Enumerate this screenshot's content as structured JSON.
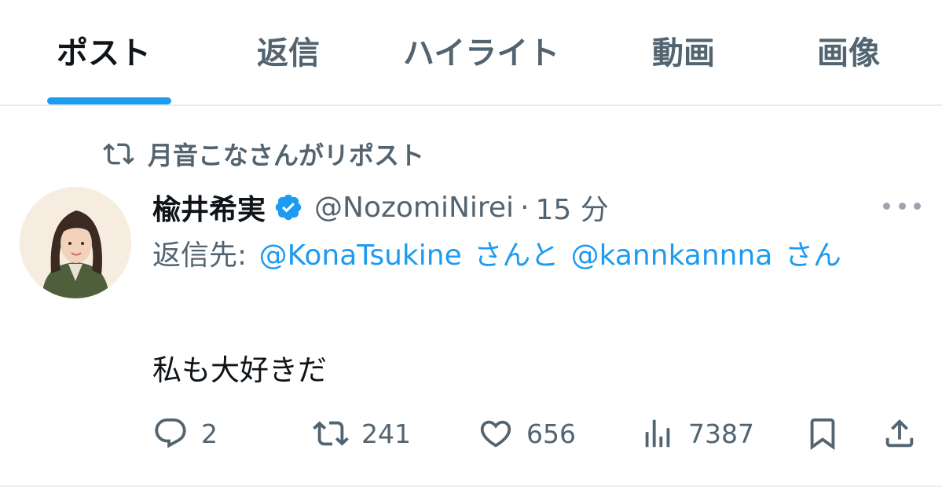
{
  "tabs": [
    {
      "label": "ポスト",
      "active": true
    },
    {
      "label": "返信",
      "active": false
    },
    {
      "label": "ハイライト",
      "active": false
    },
    {
      "label": "動画",
      "active": false
    },
    {
      "label": "画像",
      "active": false
    }
  ],
  "repost_context": {
    "text": "月音こなさんがリポスト",
    "icon": "repost-icon"
  },
  "post": {
    "display_name": "楡井希実",
    "verified": true,
    "handle": "@NozomiNirei",
    "separator": "·",
    "time": "15 分",
    "reply_to": {
      "prefix": "返信先:",
      "mention1": "@KonaTsukine",
      "joiner": "さんと",
      "mention2": "@kannkannna",
      "suffix": "さん"
    },
    "text": "私も大好きだ"
  },
  "actions": {
    "replies": "2",
    "reposts": "241",
    "likes": "656",
    "views": "7387"
  },
  "colors": {
    "accent": "#1d9bf0",
    "secondary_text": "#536471",
    "primary_text": "#0f1419"
  }
}
